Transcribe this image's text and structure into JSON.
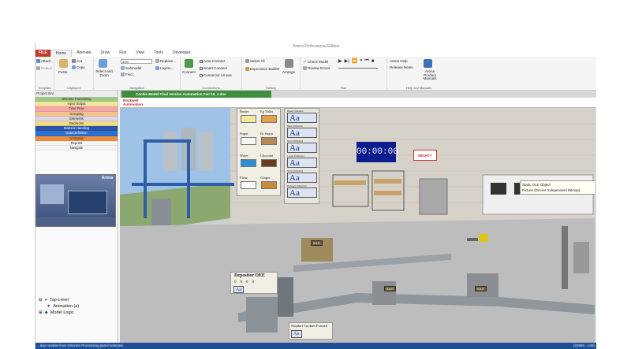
{
  "window": {
    "title": "Arena Professional Edition"
  },
  "menu": {
    "file": "FILE",
    "tabs": [
      "Home",
      "Animate",
      "Draw",
      "Run",
      "View",
      "Tools",
      "Developer"
    ]
  },
  "ribbon": {
    "template": {
      "attach": "Attach",
      "detach": "Detach",
      "label": "Template"
    },
    "clipboard": {
      "paste": "Paste",
      "cut": "Cut",
      "copy": "Copy",
      "label": "Clipboard"
    },
    "navigation": {
      "select_and_zoom": "Select and Zoom",
      "zoom_value": "53%",
      "submodel": "Submodel",
      "find": "Find...",
      "replace": "Replace...",
      "layers": "Layers...",
      "label": "Navigation"
    },
    "connections": {
      "connect": "Connect",
      "auto_connect": "Auto-Connect",
      "smart_connect": "Smart Connect",
      "connector_arrows": "Connector Arrows",
      "label": "Connections"
    },
    "editing": {
      "select_all": "Select All",
      "expression_builder": "Expression Builder",
      "arrange": "Arrange",
      "label": "Editing"
    },
    "run": {
      "check_model": "Check Model",
      "review_errors": "Review Errors",
      "label": "Run"
    },
    "help": {
      "arena_help": "Arena Help",
      "release_notes": "Release Notes",
      "arena_product_manuals": "Arena Product Manuals",
      "label": "Help and Manuals"
    }
  },
  "project_bar": {
    "title": "Project Bar",
    "panels": [
      {
        "label": "Discrete Processing",
        "color": "#9fc98a"
      },
      {
        "label": "Input Output",
        "color": "#f2e79b"
      },
      {
        "label": "Time Flow",
        "color": "#f3a6a6"
      },
      {
        "label": "Grouping",
        "color": "#f4c48d"
      },
      {
        "label": "Elements",
        "color": "#d9d4ec"
      },
      {
        "label": "Decisions",
        "color": "#f1dc7f"
      },
      {
        "label": "Material Handling",
        "color": "#2a53a8"
      },
      {
        "label": "Data Definition",
        "color": "#2c6fd1"
      },
      {
        "label": "Animation",
        "color": "#f08c3a"
      },
      {
        "label": "Reports",
        "color": "#f4f4f4"
      },
      {
        "label": "Navigate",
        "color": "#f4f4f4"
      }
    ],
    "preview_brand": "Arena",
    "tree": {
      "top_level": "Top-Level",
      "animation": "Animation (a)",
      "model_logic": "Model Logic"
    }
  },
  "document": {
    "tab_title": "Cookie Model Final Version Automation Fair 16_1.doe",
    "logo_line1": "Rockwell",
    "logo_line2": "Automation",
    "ingredients": [
      "Butter",
      "Eg Yolks",
      "Sugar",
      "Br Sugar",
      "Water",
      "Chocolat",
      "Flour",
      "Ginger"
    ],
    "aa_text": "Aa",
    "aa_labels": [
      "Blend Utilization",
      "Bake Utilization",
      "Oven Utilization",
      "Cooler Utilization",
      "Wrap Utilization",
      "Packager Utilization"
    ],
    "clock": "00:00:00",
    "mighty_logo": "MIGHTY",
    "tooltip_line1": "Static OLE Object",
    "tooltip_line2": "Picture (Device Independent Bitmap)",
    "depositor_oee_title": "Depositor OEE",
    "depositor_values": [
      "0",
      "0",
      "0",
      "0"
    ],
    "machine_labels": [
      "IDLE",
      "IDLE",
      "IDLE"
    ],
    "standard_cookies_label": "Standart Cookies Formed"
  },
  "status": {
    "message": "...day module from Discrete Processing panel selected.",
    "coords": "(22660, -148)"
  },
  "colors": {
    "accent_green": "#3e8e3e",
    "status_blue": "#1f4f93",
    "file_red": "#c0392b",
    "clock_blue": "#0c1c8c"
  }
}
